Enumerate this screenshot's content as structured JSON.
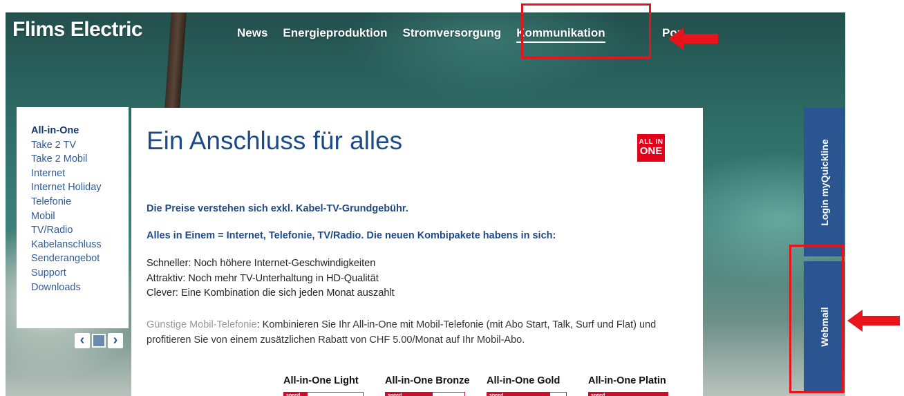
{
  "header": {
    "logo": "Flims Electric",
    "nav": [
      "News",
      "Energieproduktion",
      "Stromversorgung",
      "Kommunikation",
      "Portrait"
    ],
    "active_nav": "Kommunikation"
  },
  "sidebar": {
    "items": [
      "All-in-One",
      "Take 2 TV",
      "Take 2 Mobil",
      "Internet",
      "Internet Holiday",
      "Telefonie",
      "Mobil",
      "TV/Radio",
      "Kabelanschluss",
      "Senderangebot",
      "Support",
      "Downloads"
    ],
    "active": "All-in-One"
  },
  "content": {
    "title": "Ein Anschluss für alles",
    "badge_line1": "ALL IN",
    "badge_line2": "ONE",
    "para1": "Die Preise verstehen sich exkl. Kabel-TV-Grundgebühr.",
    "para2": "Alles in Einem = Internet, Telefonie, TV/Radio. Die neuen Kombipakete habens in sich:",
    "features": [
      "Schneller: Noch höhere Internet-Geschwindigkeiten",
      "Attraktiv: Noch mehr TV-Unterhaltung in HD-Qualität",
      "Clever: Eine Kombination die sich jeden Monat auszahlt"
    ],
    "mobil_link": "Günstige Mobil-Telefonie",
    "mobil_text": ": Kombinieren Sie Ihr All-in-One mit Mobil-Telefonie (mit Abo Start, Talk, Surf und Flat) und profitieren Sie von einem zusätzlichen Rabatt von CHF 5.00/Monat auf Ihr Mobil-Abo.",
    "packages": [
      {
        "name": "All-in-One Light",
        "speed_label": "speed",
        "speed_fraction": 0.3
      },
      {
        "name": "All-in-One Bronze",
        "speed_label": "speed",
        "speed_fraction": 0.6
      },
      {
        "name": "All-in-One Gold",
        "speed_label": "speed",
        "speed_fraction": 0.8
      },
      {
        "name": "All-in-One Platin",
        "speed_label": "speed",
        "speed_fraction": 1.0
      }
    ]
  },
  "side_tabs": {
    "login": "Login myQuickline",
    "webmail": "Webmail"
  },
  "colors": {
    "brand_blue": "#1e4a87",
    "tab_blue": "#2a5590",
    "badge_red": "#e2001a",
    "highlight_red": "#e8141b"
  }
}
